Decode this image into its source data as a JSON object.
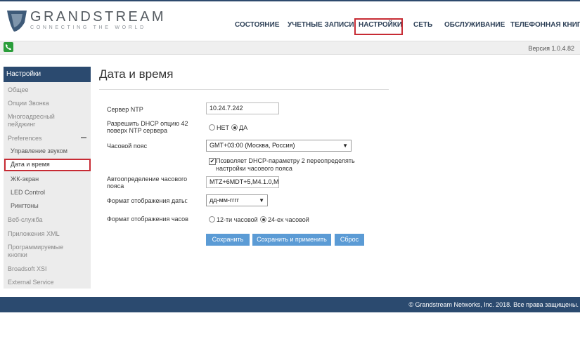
{
  "header": {
    "brand": "GRANDSTREAM",
    "tagline": "CONNECTING THE WORLD",
    "nav": [
      "СОСТОЯНИЕ",
      "УЧЕТНЫЕ ЗАПИСИ",
      "НАСТРОЙКИ",
      "СЕТЬ",
      "ОБСЛУЖИВАНИЕ",
      "ТЕЛЕФОННАЯ КНИГА"
    ],
    "active_nav": "НАСТРОЙКИ"
  },
  "subbar": {
    "version": "Версия 1.0.4.82"
  },
  "sidebar": {
    "title": "Настройки",
    "items": [
      "Общее",
      "Опции Звонка",
      "Многоадресный пейджинг",
      "Preferences",
      "Управление звуком",
      "Дата и время",
      "ЖК-экран",
      "LED Control",
      "Рингтоны",
      "Веб-служба",
      "Приложения XML",
      "Программируемые кнопки",
      "Broadsoft XSI",
      "External Service"
    ],
    "active": "Дата и время"
  },
  "main": {
    "title": "Дата и время",
    "ntp_label": "Сервер NTP",
    "ntp_value": "10.24.7.242",
    "dhcp42_label": "Разрешить DHCP опцию 42 поверх NTP сервера",
    "dhcp42_no": "НЕТ",
    "dhcp42_yes": "ДА",
    "dhcp42_selected": "ДА",
    "tz_label": "Часовой пояс",
    "tz_value": "GMT+03:00 (Москва, Россия)",
    "dhcp2_text": "Позволяет DHCP-параметру 2 переопределять настройки часового пояса",
    "dhcp2_checked": true,
    "auto_tz_label": "Автоопределение часового пояса",
    "auto_tz_value": "MTZ+6MDT+5,M4.1.0,M",
    "date_format_label": "Формат отображения даты:",
    "date_format_value": "дд-мм-гггг",
    "time_format_label": "Формат отображения часов",
    "time_12": "12-ти часовой",
    "time_24": "24-ех часовой",
    "time_selected": "24-ех часовой",
    "btn_save": "Сохранить",
    "btn_save_apply": "Сохранить и применить",
    "btn_reset": "Сброс"
  },
  "footer": {
    "copyright": "© Grandstream Networks, Inc. 2018. Все права защищены."
  },
  "colors": {
    "navy": "#2b4a6f",
    "highlight": "#c72b34",
    "button": "#5b9bd5"
  }
}
